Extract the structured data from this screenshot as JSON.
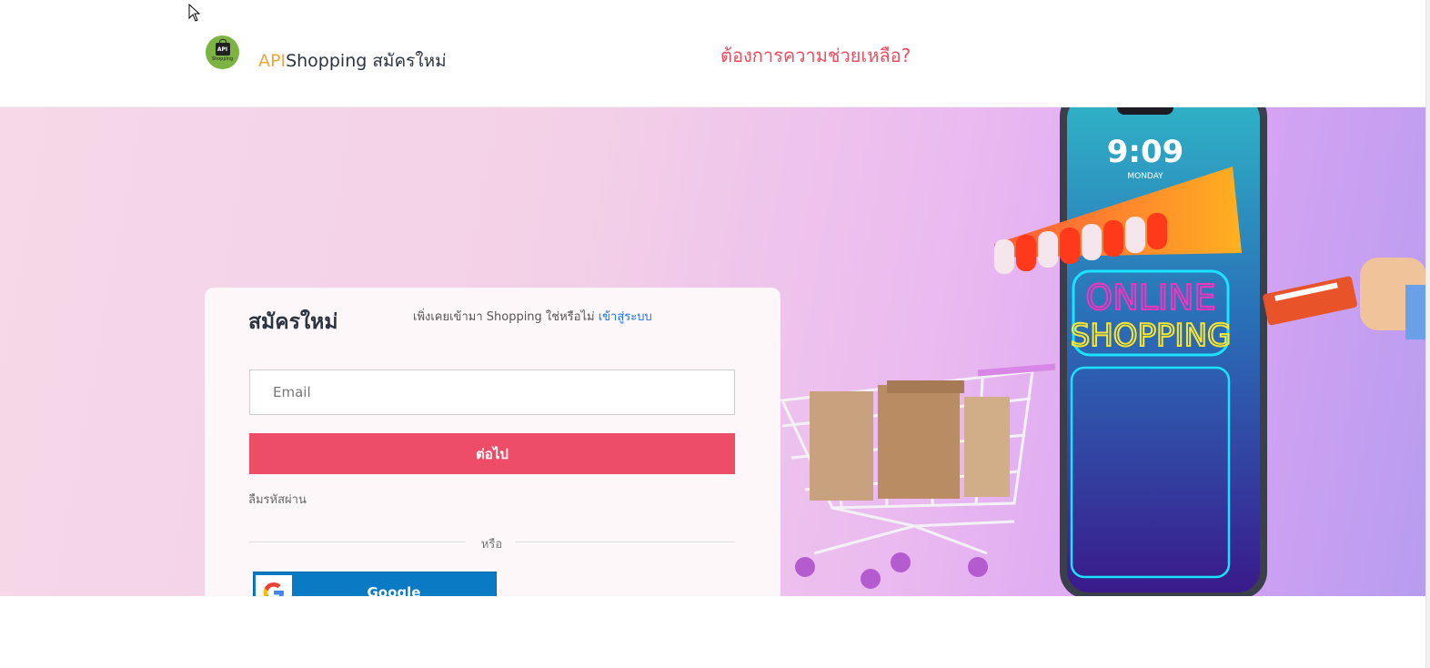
{
  "header": {
    "logo_text": "API",
    "logo_caption": "Shopping",
    "brand_accent": "API",
    "brand_rest": "Shopping สมัครใหม่",
    "help_link": "ต้องการความช่วยเหลือ?"
  },
  "signup": {
    "title": "สมัครใหม่",
    "already_text": "เพิ่งเคยเข้ามา Shopping ใช่หรือไม่",
    "login_link": "เข้าสู่ระบบ",
    "email_placeholder": "Email",
    "next_button": "ต่อไป",
    "forgot_password": "ลืมรหัสผ่าน",
    "or_text": "หรือ",
    "google_button": "Google"
  },
  "illustration": {
    "phone_time": "9:09",
    "phone_day": "MONDAY",
    "sign_line1": "ONLINE",
    "sign_line2": "SHOPPING"
  },
  "colors": {
    "accent": "#ee4d67",
    "brand_orange": "#f0a43a",
    "link_blue": "#1a73e8",
    "google_blue": "#0a7ac4"
  },
  "icons": [
    "cursor-icon",
    "logo-icon",
    "google-icon"
  ]
}
